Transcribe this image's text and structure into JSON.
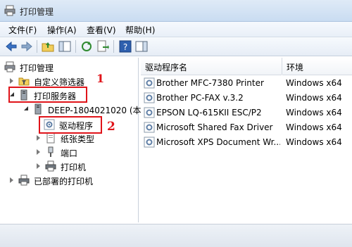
{
  "window": {
    "title": "打印管理"
  },
  "menu": [
    "文件(F)",
    "操作(A)",
    "查看(V)",
    "帮助(H)"
  ],
  "toolbar": {
    "buttons": [
      "back-arrow-icon",
      "forward-arrow-icon",
      "up-folder-icon",
      "show-hide-tree-icon",
      "refresh-icon",
      "export-list-icon",
      "help-icon",
      "show-hide-action-icon"
    ]
  },
  "tree": {
    "root": "打印管理",
    "custom_filters": "自定义筛选器",
    "print_servers": "打印服务器",
    "server": "DEEP-1804021020 (本",
    "drivers": "驱动程序",
    "forms": "纸张类型",
    "ports": "端口",
    "printers": "打印机",
    "deployed": "已部署的打印机"
  },
  "annotations": {
    "mark1": "1",
    "mark2": "2"
  },
  "list": {
    "columns": [
      "驱动程序名",
      "环境"
    ],
    "rows": [
      {
        "name": "Brother MFC-7380 Printer",
        "env": "Windows x64"
      },
      {
        "name": "Brother PC-FAX v.3.2",
        "env": "Windows x64"
      },
      {
        "name": "EPSON LQ-615KII ESC/P2",
        "env": "Windows x64"
      },
      {
        "name": "Microsoft Shared Fax Driver",
        "env": "Windows x64"
      },
      {
        "name": "Microsoft XPS Document Wr...",
        "env": "Windows x64"
      }
    ]
  },
  "colors": {
    "highlight": "#e0141a",
    "accent": "#3a72c4"
  }
}
